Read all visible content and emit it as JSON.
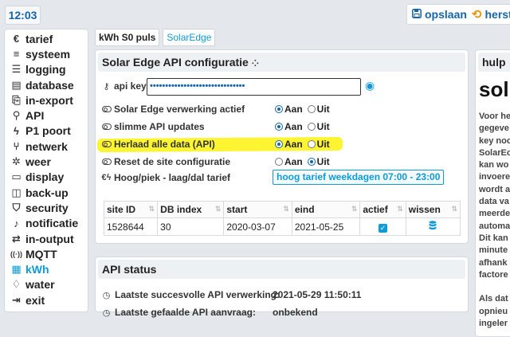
{
  "clock": "12:03",
  "topbar": {
    "save_label": "opslaan",
    "save_icon": "floppy-icon",
    "undo_label": "herst",
    "undo_icon": "undo-icon"
  },
  "sidebar": {
    "items": [
      {
        "label": "tarief",
        "icon": "€"
      },
      {
        "label": "systeem",
        "icon": "≡"
      },
      {
        "label": "logging",
        "icon": "☰"
      },
      {
        "label": "database",
        "icon": "▤"
      },
      {
        "label": "in-export",
        "icon": "⎘"
      },
      {
        "label": "API",
        "icon": "⚲"
      },
      {
        "label": "P1 poort",
        "icon": "ϟ"
      },
      {
        "label": "netwerk",
        "icon": "⑂"
      },
      {
        "label": "weer",
        "icon": "✲"
      },
      {
        "label": "display",
        "icon": "▭"
      },
      {
        "label": "back-up",
        "icon": "◫"
      },
      {
        "label": "security",
        "icon": "⛉"
      },
      {
        "label": "notificatie",
        "icon": "♪"
      },
      {
        "label": "in-output",
        "icon": "⇄"
      },
      {
        "label": "MQTT",
        "icon": "((·))"
      },
      {
        "label": "kWh",
        "icon": "▦"
      },
      {
        "label": "water",
        "icon": "♢"
      },
      {
        "label": "exit",
        "icon": "⇥"
      }
    ]
  },
  "tabs": {
    "s0": "kWh S0 puls",
    "solaredge": "SolarEdge"
  },
  "api_panel": {
    "title": "Solar Edge API configuratie",
    "api_key_label": "api key",
    "api_key_value": "•••••••••••••••••••••••••••••••",
    "rows": [
      {
        "label": "Solar Edge verwerking actief",
        "aan": "Aan",
        "uit": "Uit",
        "selected": "aan"
      },
      {
        "label": "slimme API updates",
        "aan": "Aan",
        "uit": "Uit",
        "selected": "aan"
      },
      {
        "label": "Herlaad alle data (API)",
        "aan": "Aan",
        "uit": "Uit",
        "selected": "aan"
      },
      {
        "label": "Reset de site configuratie",
        "aan": "Aan",
        "uit": "Uit",
        "selected": "uit"
      }
    ],
    "peak_label": "Hoog/piek - laag/dal tarief",
    "peak_value": "hoog tarief weekdagen 07:00 - 23:00",
    "table": {
      "headers": [
        "site ID",
        "DB index",
        "start",
        "eind",
        "actief",
        "wissen"
      ],
      "rows": [
        {
          "site_id": "1528644",
          "db_index": "30",
          "start": "2020-03-07",
          "eind": "2021-05-25",
          "actief": true
        }
      ]
    }
  },
  "status_panel": {
    "title": "API status",
    "last_success_label": "Laatste succesvolle API verwerking:",
    "last_success_value": "2021-05-29 11:50:11",
    "last_fail_label": "Laatste gefaalde API aanvraag:",
    "last_fail_value": "onbekend"
  },
  "help_panel": {
    "title": "hulp",
    "big": "sol",
    "text": "Voor he\ngegeve\nkey noc\nSolarEc\nkan wo\ninvoere\nwordt a\ndata va\nmeerde\nautoma\nDit kan\nminute\nafhank\nfactore\n\nAls dat\nopnieu\ningeler"
  },
  "colors": {
    "accent": "#0e9bd8",
    "brand_blue": "#1565a8",
    "highlight": "#fdf31c",
    "undo": "#e59400"
  }
}
